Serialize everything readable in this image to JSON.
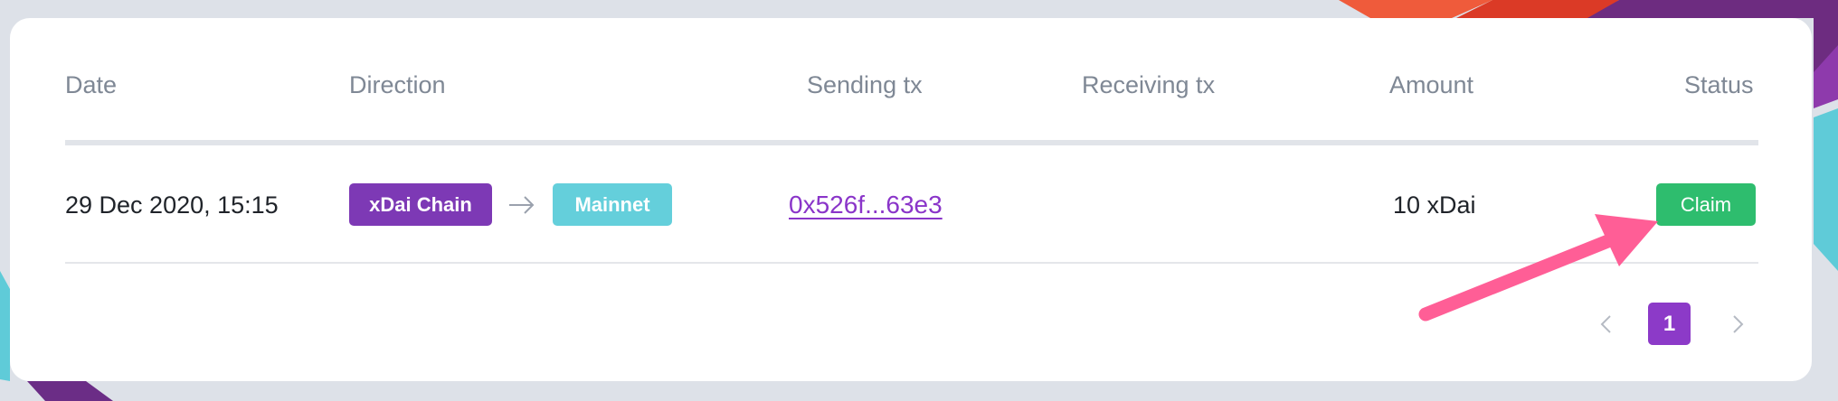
{
  "table": {
    "headers": {
      "date": "Date",
      "direction": "Direction",
      "sending_tx": "Sending tx",
      "receiving_tx": "Receiving tx",
      "amount": "Amount",
      "status": "Status"
    },
    "rows": [
      {
        "date": "29 Dec 2020, 15:15",
        "from_chain": "xDai Chain",
        "to_chain": "Mainnet",
        "sending_tx": "0x526f...63e3",
        "receiving_tx": "",
        "amount": "10 xDai",
        "status_action": "Claim"
      }
    ]
  },
  "pagination": {
    "current_page": "1",
    "prev_icon": "chevron-left-icon",
    "next_icon": "chevron-right-icon"
  },
  "colors": {
    "from_chain": "#7d39b5",
    "to_chain": "#64cfdb",
    "claim": "#2ebd6e",
    "link": "#8a35c9",
    "active_page": "#8c3ac8",
    "annotation_arrow": "#ff5e96"
  }
}
